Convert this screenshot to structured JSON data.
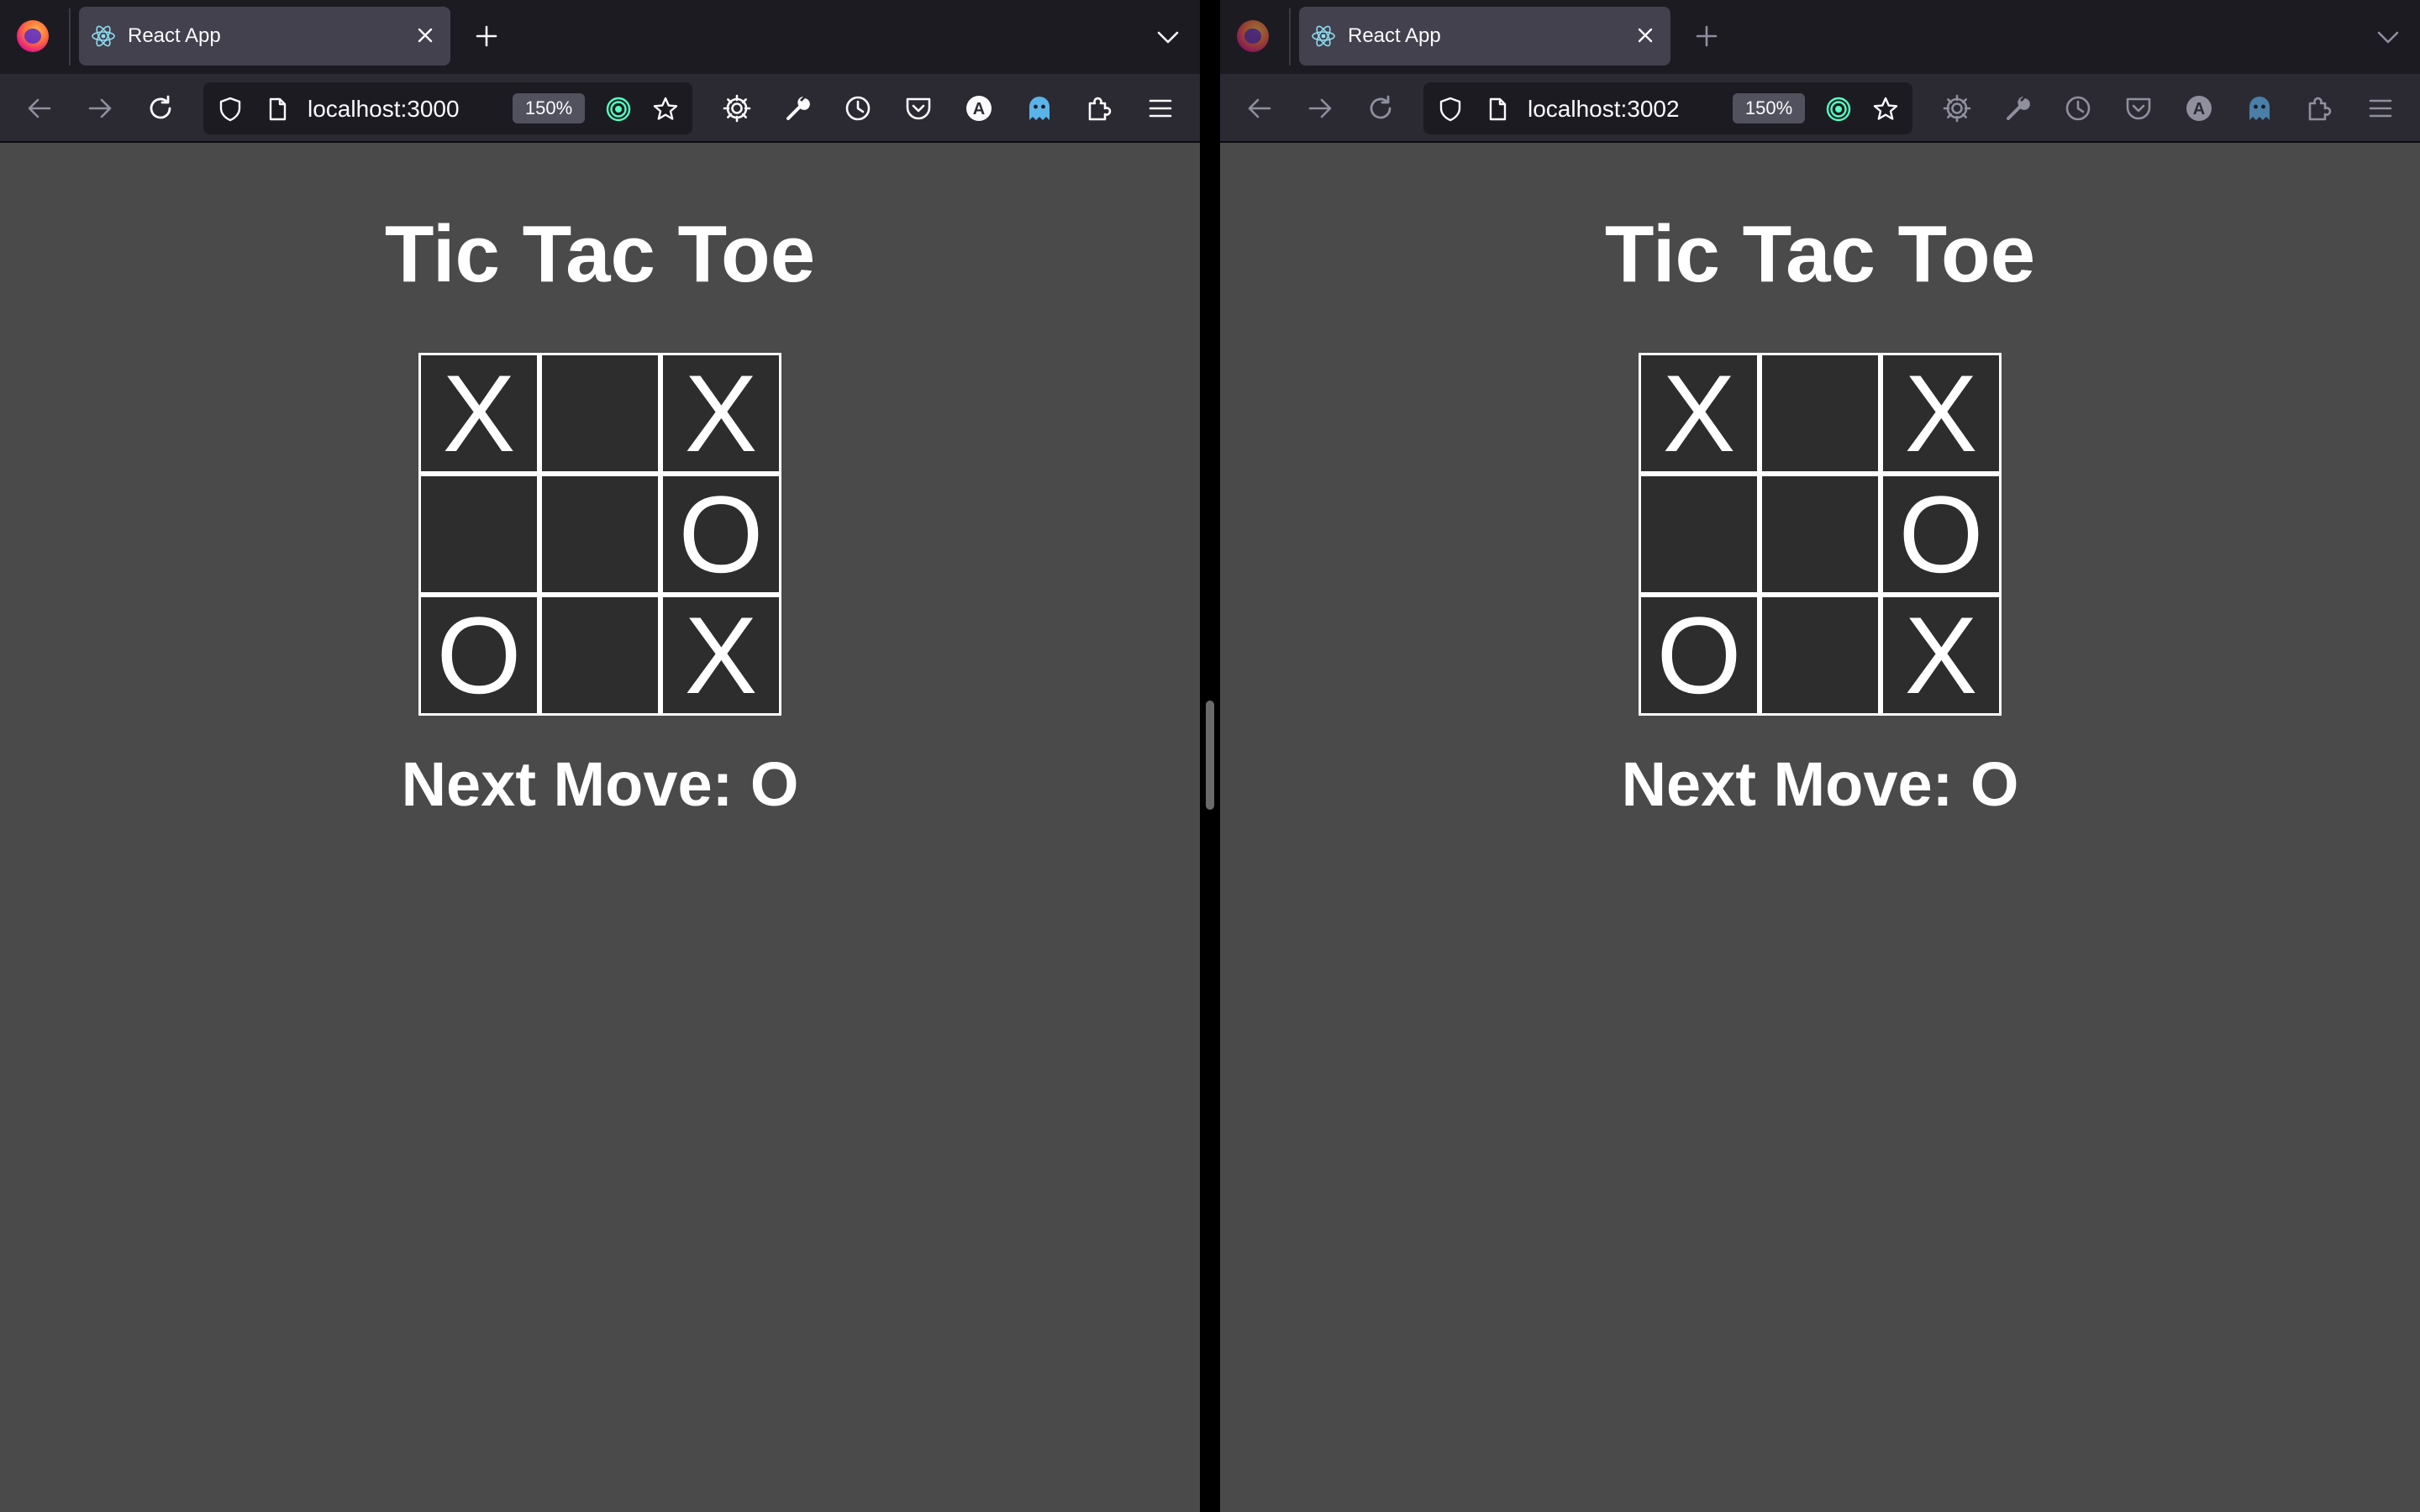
{
  "windows": [
    {
      "tab": {
        "title": "React App"
      },
      "url": "localhost:3000",
      "zoom": "150%",
      "page": {
        "title": "Tic Tac Toe",
        "board": [
          "X",
          "",
          "X",
          "",
          "",
          "O",
          "O",
          "",
          "X"
        ],
        "status": "Next Move: O"
      }
    },
    {
      "tab": {
        "title": "React App"
      },
      "url": "localhost:3002",
      "zoom": "150%",
      "page": {
        "title": "Tic Tac Toe",
        "board": [
          "X",
          "",
          "X",
          "",
          "",
          "O",
          "O",
          "",
          "X"
        ],
        "status": "Next Move: O"
      }
    }
  ],
  "colors": {
    "page_background": "#4a4a4a",
    "cell_background": "#2d2d2d",
    "cell_border": "#ffffff",
    "text": "#ffffff",
    "toolbar": "#2b2a33",
    "tabbar": "#1c1b22"
  },
  "icons": {
    "toolbar": [
      "back-arrow-icon",
      "forward-arrow-icon",
      "reload-icon",
      "shield-icon",
      "page-icon",
      "zoom-badge",
      "target-icon",
      "star-icon",
      "gear-icon",
      "wrench-icon",
      "history-clock-icon",
      "pocket-icon",
      "account-a-icon",
      "ghost-icon",
      "extensions-puzzle-icon",
      "menu-hamburger-icon"
    ]
  }
}
